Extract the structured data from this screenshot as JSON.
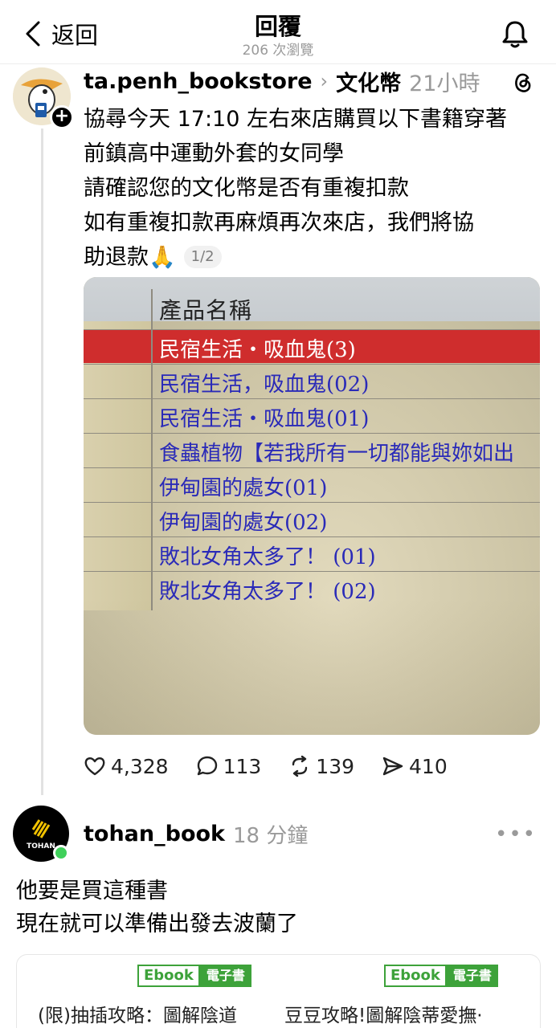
{
  "header": {
    "back_label": "返回",
    "title": "回覆",
    "view_count": "206 次瀏覽"
  },
  "post": {
    "username": "ta.penh_bookstore",
    "community": "文化幣",
    "time": "21小時",
    "text_lines": [
      "協尋今天 17:10 左右來店購買以下書籍穿著",
      "前鎮高中運動外套的女同學",
      "請確認您的文化幣是否有重複扣款",
      "如有重複扣款再麻煩再次來店，我們將協",
      "助退款🙏"
    ],
    "media_pager": "1/2",
    "photo": {
      "column_header": "產品名稱",
      "rows": [
        "民宿生活・吸血鬼(3)",
        "民宿生活，吸血鬼(02)",
        "民宿生活・吸血鬼(01)",
        "食蟲植物【若我所有一切都能與妳如出",
        "伊甸園的處女(01)",
        "伊甸園的處女(02)",
        "敗北女角太多了！ (01)",
        "敗北女角太多了！ (02)"
      ]
    },
    "stats": {
      "likes": "4,328",
      "comments": "113",
      "reposts": "139",
      "shares": "410"
    }
  },
  "reply": {
    "username": "tohan_book",
    "time": "18 分鐘",
    "avatar_text": "TOHAN",
    "text_lines": [
      "他要是買這種書",
      "現在就可以準備出發去波蘭了"
    ],
    "card": {
      "badge_main": "Ebook",
      "badge_sub": "電子書",
      "books": [
        "(限)抽插攻略：圖解陰道",
        "豆豆攻略!圖解陰蒂愛撫·"
      ]
    }
  },
  "icons": {
    "back": "chevron-left-icon",
    "bell": "bell-icon",
    "threads": "threads-logo-icon",
    "like": "heart-icon",
    "comment": "comment-bubble-icon",
    "repost": "repost-icon",
    "share": "send-icon",
    "more": "more-horizontal-icon"
  },
  "colors": {
    "accent_green": "#3da23a",
    "online": "#3fd05a",
    "muted": "#9a9a9a",
    "highlight_row": "#cf2d2d"
  }
}
